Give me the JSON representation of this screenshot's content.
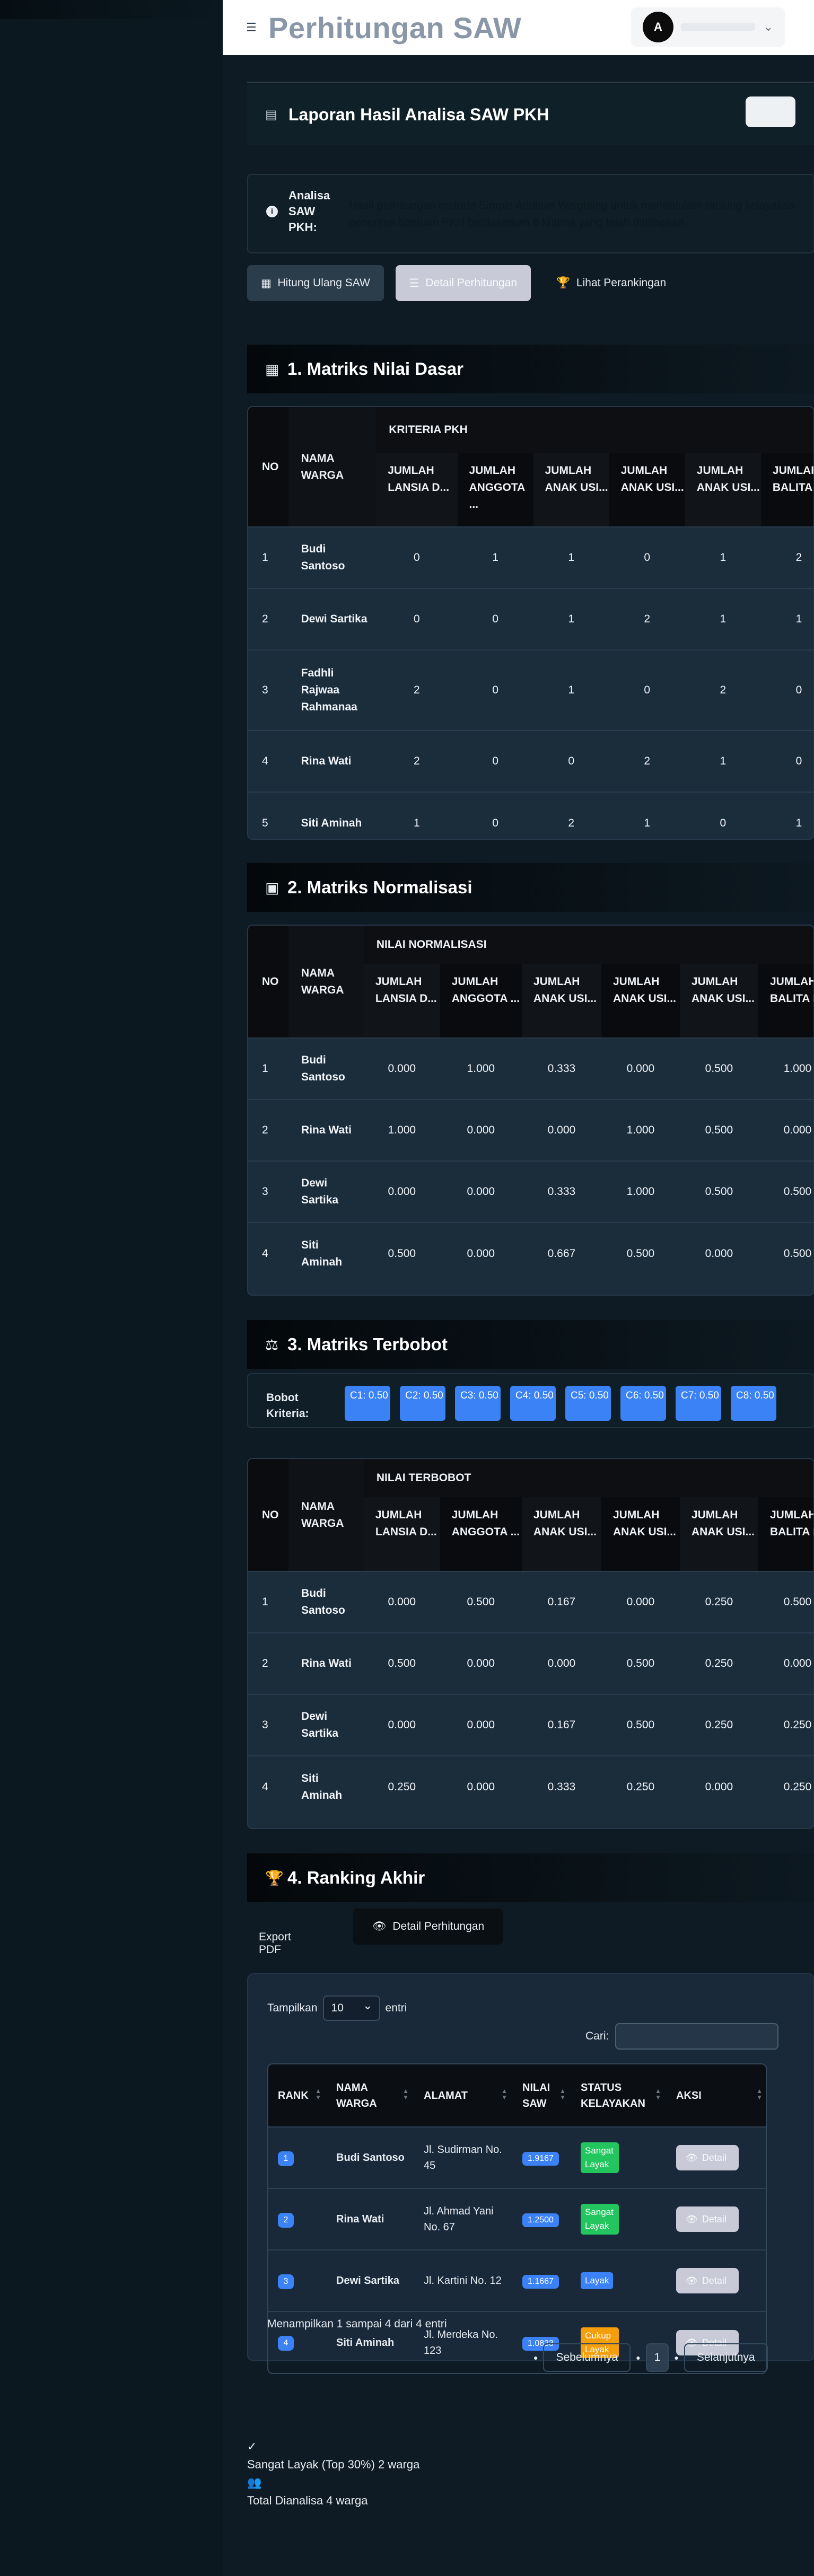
{
  "header": {
    "menu_icon": "menu-icon",
    "title": "Perhitungan SAW",
    "avatar_initial": "A"
  },
  "report": {
    "title": "Laporan Hasil Analisa SAW PKH"
  },
  "info": {
    "label": "Analisa SAW PKH:",
    "text": "Hasil perhitungan metode Simple Additive Weighting untuk menentukan ranking kelayakan penerima bantuan PKH berdasarkan 8 kriteria yang telah ditetapkan."
  },
  "actions": {
    "recalc": "Hitung Ulang SAW",
    "detail": "Detail Perhitungan",
    "ranking": "Lihat Perankingan"
  },
  "s1": {
    "title": "1. Matriks Nilai Dasar",
    "group": "KRITERIA PKH",
    "no": "NO",
    "name": "NAMA WARGA",
    "cols": [
      "JUMLAH LANSIA D...",
      "JUMLAH ANGGOTA ...",
      "JUMLAH ANAK USI...",
      "JUMLAH ANAK USI...",
      "JUMLAH ANAK USI...",
      "JUMLAH BALITA D..."
    ],
    "rows": [
      {
        "no": "1",
        "name": "Budi Santoso",
        "v": [
          "0",
          "1",
          "1",
          "0",
          "1",
          "2"
        ]
      },
      {
        "no": "2",
        "name": "Dewi Sartika",
        "v": [
          "0",
          "0",
          "1",
          "2",
          "1",
          "1"
        ]
      },
      {
        "no": "3",
        "name": "Fadhli Rajwaa Rahmanaa",
        "v": [
          "2",
          "0",
          "1",
          "0",
          "2",
          "0"
        ]
      },
      {
        "no": "4",
        "name": "Rina Wati",
        "v": [
          "2",
          "0",
          "0",
          "2",
          "1",
          "0"
        ]
      },
      {
        "no": "5",
        "name": "Siti Aminah",
        "v": [
          "1",
          "0",
          "2",
          "1",
          "0",
          "1"
        ]
      }
    ]
  },
  "s2": {
    "title": "2. Matriks Normalisasi",
    "group": "NILAI NORMALISASI",
    "no": "NO",
    "name": "NAMA WARGA",
    "cols": [
      "JUMLAH LANSIA D...",
      "JUMLAH ANGGOTA ...",
      "JUMLAH ANAK USI...",
      "JUMLAH ANAK USI...",
      "JUMLAH ANAK USI...",
      "JUMLAH BALITA D..."
    ],
    "rows": [
      {
        "no": "1",
        "name": "Budi Santoso",
        "v": [
          "0.000",
          "1.000",
          "0.333",
          "0.000",
          "0.500",
          "1.000"
        ]
      },
      {
        "no": "2",
        "name": "Rina Wati",
        "v": [
          "1.000",
          "0.000",
          "0.000",
          "1.000",
          "0.500",
          "0.000"
        ]
      },
      {
        "no": "3",
        "name": "Dewi Sartika",
        "v": [
          "0.000",
          "0.000",
          "0.333",
          "1.000",
          "0.500",
          "0.500"
        ]
      },
      {
        "no": "4",
        "name": "Siti Aminah",
        "v": [
          "0.500",
          "0.000",
          "0.667",
          "0.500",
          "0.000",
          "0.500"
        ]
      }
    ]
  },
  "s3": {
    "title": "3. Matriks Terbobot",
    "bobot_label": "Bobot Kriteria:",
    "chips": [
      "C1: 0.50",
      "C2: 0.50",
      "C3: 0.50",
      "C4: 0.50",
      "C5: 0.50",
      "C6: 0.50",
      "C7: 0.50",
      "C8: 0.50"
    ],
    "group": "NILAI TERBOBOT",
    "no": "NO",
    "name": "NAMA WARGA",
    "cols": [
      "JUMLAH LANSIA D...",
      "JUMLAH ANGGOTA ...",
      "JUMLAH ANAK USI...",
      "JUMLAH ANAK USI...",
      "JUMLAH ANAK USI...",
      "JUMLAH BALITA D..."
    ],
    "rows": [
      {
        "no": "1",
        "name": "Budi Santoso",
        "v": [
          "0.000",
          "0.500",
          "0.167",
          "0.000",
          "0.250",
          "0.500"
        ]
      },
      {
        "no": "2",
        "name": "Rina Wati",
        "v": [
          "0.500",
          "0.000",
          "0.000",
          "0.500",
          "0.250",
          "0.000"
        ]
      },
      {
        "no": "3",
        "name": "Dewi Sartika",
        "v": [
          "0.000",
          "0.000",
          "0.167",
          "0.500",
          "0.250",
          "0.250"
        ]
      },
      {
        "no": "4",
        "name": "Siti Aminah",
        "v": [
          "0.250",
          "0.000",
          "0.333",
          "0.250",
          "0.000",
          "0.250"
        ]
      }
    ]
  },
  "s4": {
    "title": "4. Ranking Akhir",
    "export": "Export PDF",
    "detail": "Detail Perhitungan",
    "show_label": "Tampilkan",
    "show_value": "10",
    "entries": "entri",
    "search_label": "Cari:",
    "cols": [
      "RANK",
      "NAMA WARGA",
      "ALAMAT",
      "NILAI SAW",
      "STATUS KELAYAKAN",
      "AKSI"
    ],
    "rows": [
      {
        "rank": "1",
        "name": "Budi Santoso",
        "alamat": "Jl. Sudirman No. 45",
        "saw": "1.9167",
        "status": "Sangat Layak",
        "status_color": "#22c55e",
        "aksi": "Detail"
      },
      {
        "rank": "2",
        "name": "Rina Wati",
        "alamat": "Jl. Ahmad Yani No. 67",
        "saw": "1.2500",
        "status": "Sangat Layak",
        "status_color": "#22c55e",
        "aksi": "Detail"
      },
      {
        "rank": "3",
        "name": "Dewi Sartika",
        "alamat": "Jl. Kartini No. 12",
        "saw": "1.1667",
        "status": "Layak",
        "status_color": "#3b82f6",
        "aksi": "Detail"
      },
      {
        "rank": "4",
        "name": "Siti Aminah",
        "alamat": "Jl. Merdeka No. 123",
        "saw": "1.0833",
        "status": "Cukup Layak",
        "status_color": "#f59e0b",
        "aksi": "Detail"
      }
    ],
    "footer": "Menampilkan 1 sampai 4 dari 4 entri",
    "prev": "Sebelumnya",
    "page": "1",
    "next": "Selanjutnya"
  },
  "summary": {
    "layak": "Sangat Layak (Top 30%) 2 warga",
    "total": "Total Dianalisa 4 warga"
  }
}
